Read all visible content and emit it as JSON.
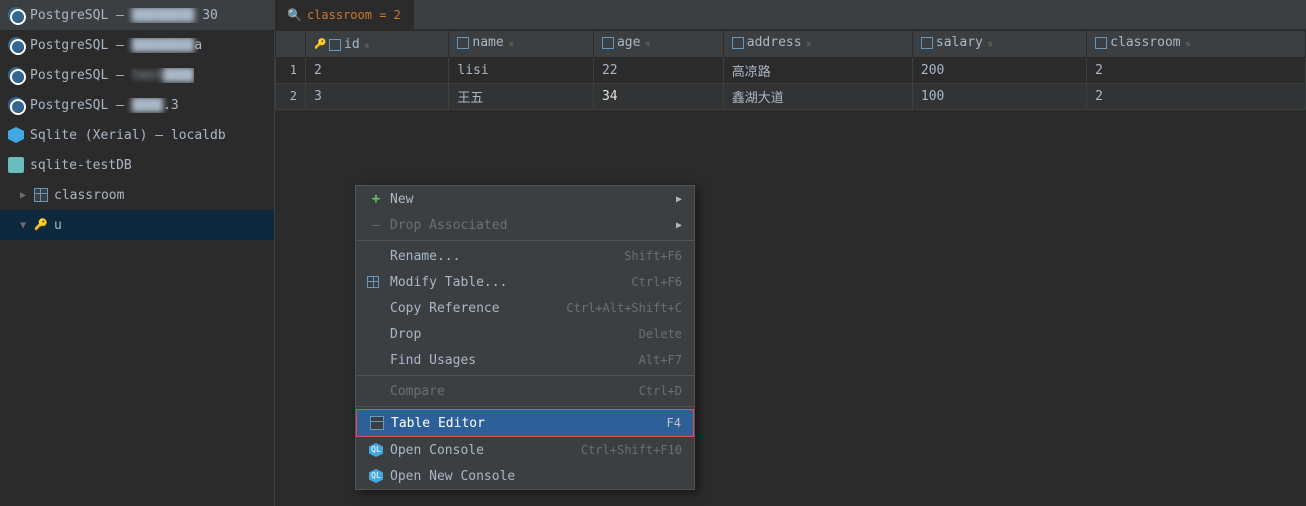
{
  "sidebar": {
    "items": [
      {
        "id": "pg1",
        "type": "postgresql",
        "label": "PostgreSQL –",
        "suffix": "30",
        "blurred": true
      },
      {
        "id": "pg2",
        "type": "postgresql",
        "label": "PostgreSQL –",
        "suffix": "a",
        "blurred": true
      },
      {
        "id": "pg3",
        "type": "postgresql",
        "label": "PostgreSQL – test",
        "suffix": "",
        "blurred": true
      },
      {
        "id": "pg4",
        "type": "postgresql",
        "label": "PostgreSQL –",
        "suffix": "3",
        "blurred": true
      },
      {
        "id": "sqlite1",
        "type": "sqlite",
        "label": "Sqlite (Xerial) – localdb",
        "blurred": false
      },
      {
        "id": "sqlite2",
        "type": "sqlite-plain",
        "label": "sqlite-testDB",
        "blurred": false
      },
      {
        "id": "classroom",
        "type": "table",
        "label": "classroom",
        "blurred": false,
        "indent": 1
      },
      {
        "id": "u-table",
        "type": "table-key",
        "label": "u",
        "blurred": false,
        "indent": 1
      }
    ]
  },
  "tab": {
    "icon": "search",
    "filter": "classroom = 2"
  },
  "grid": {
    "columns": [
      {
        "name": "id",
        "type": "int",
        "hasKey": true
      },
      {
        "name": "name",
        "type": "varchar"
      },
      {
        "name": "age",
        "type": "int"
      },
      {
        "name": "address",
        "type": "varchar"
      },
      {
        "name": "salary",
        "type": "int"
      },
      {
        "name": "classroom",
        "type": "int"
      }
    ],
    "rows": [
      {
        "rowNum": "1",
        "id": "2",
        "name": "lisi",
        "age": "22",
        "address": "高凉路",
        "salary": "200",
        "classroom": "2"
      },
      {
        "rowNum": "2",
        "id": "3",
        "name": "王五",
        "age": "34",
        "address": "鑫湖大道",
        "salary": "100",
        "classroom": "2"
      }
    ],
    "selectedCell": {
      "row": 1,
      "col": "age"
    }
  },
  "contextMenu": {
    "items": [
      {
        "id": "new",
        "label": "New",
        "shortcut": "",
        "hasArrow": true,
        "type": "new",
        "disabled": false
      },
      {
        "id": "drop-associated",
        "label": "Drop Associated",
        "shortcut": "",
        "hasArrow": true,
        "type": "normal",
        "disabled": true
      },
      {
        "id": "rename",
        "label": "Rename...",
        "shortcut": "Shift+F6",
        "hasArrow": false,
        "type": "normal",
        "disabled": false
      },
      {
        "id": "modify-table",
        "label": "Modify Table...",
        "shortcut": "Ctrl+F6",
        "hasArrow": false,
        "type": "normal",
        "disabled": false
      },
      {
        "id": "copy-reference",
        "label": "Copy Reference",
        "shortcut": "Ctrl+Alt+Shift+C",
        "hasArrow": false,
        "type": "normal",
        "disabled": false
      },
      {
        "id": "drop",
        "label": "Drop",
        "shortcut": "Delete",
        "hasArrow": false,
        "type": "normal",
        "disabled": false
      },
      {
        "id": "find-usages",
        "label": "Find Usages",
        "shortcut": "Alt+F7",
        "hasArrow": false,
        "type": "normal",
        "disabled": false
      },
      {
        "id": "compare",
        "label": "Compare",
        "shortcut": "Ctrl+D",
        "hasArrow": false,
        "type": "normal",
        "disabled": true
      },
      {
        "id": "table-editor",
        "label": "Table Editor",
        "shortcut": "F4",
        "hasArrow": false,
        "type": "highlighted",
        "disabled": false
      },
      {
        "id": "open-console",
        "label": "Open Console",
        "shortcut": "Ctrl+Shift+F10",
        "hasArrow": false,
        "type": "console",
        "disabled": false
      },
      {
        "id": "open-new-console",
        "label": "Open New Console",
        "shortcut": "",
        "hasArrow": false,
        "type": "console",
        "disabled": false
      }
    ]
  }
}
